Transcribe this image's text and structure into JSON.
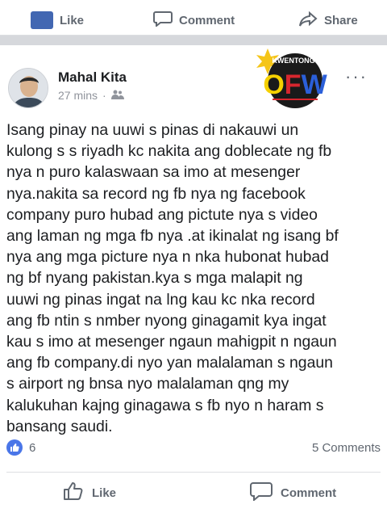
{
  "prev_post": {
    "like_label": "Like",
    "comment_label": "Comment",
    "share_label": "Share"
  },
  "post": {
    "author": "Mahal Kita",
    "time": "27 mins",
    "privacy_icon": "friends-icon",
    "body": "Isang pinay na uuwi s pinas di nakauwi un\nkulong s s riyadh kc nakita ang doblecate ng fb\nnya n puro kalaswaan sa imo at mesenger\nnya.nakita sa record ng fb nya ng facebook\ncompany puro hubad ang pictute nya s video\nang laman ng mga fb nya .at ikinalat ng isang bf\nnya ang mga picture nya n nka hubonat hubad\nng bf nyang pakistan.kya s mga malapit ng\nuuwi ng pinas ingat na lng kau kc nka record\nang fb ntin s nmber nyong ginagamit kya ingat\nkau s imo at mesenger ngaun mahigpit n ngaun\nang fb company.di nyo yan malalaman s ngaun\ns airport ng bnsa nyo malalaman qng my\nkalukuhan kajng ginagawa s fb nyo n haram s\nbansang saudi.",
    "reaction_count": "6",
    "comments_count": "5 Comments",
    "like_label": "Like",
    "comment_label": "Comment"
  },
  "logo": {
    "word_top": "KWENTONG",
    "word_main": "OFW"
  },
  "colors": {
    "accent": "#4267b2",
    "like_bubble": "#4a76e8",
    "muted": "#606770"
  }
}
